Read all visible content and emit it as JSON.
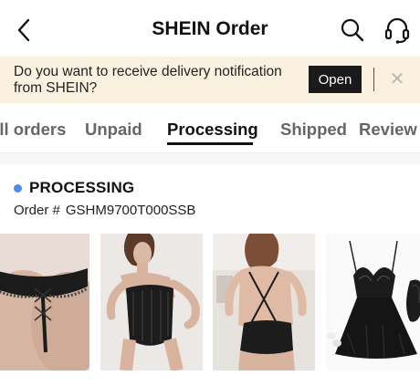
{
  "header": {
    "title": "SHEIN Order"
  },
  "notice": {
    "text": "Do you want to receive delivery notification from SHEIN?",
    "open_label": "Open",
    "close_symbol": "✕"
  },
  "tabs": [
    {
      "label": "All orders"
    },
    {
      "label": "Unpaid"
    },
    {
      "label": "Processing"
    },
    {
      "label": "Shipped"
    },
    {
      "label": "Review"
    }
  ],
  "active_tab": "Processing",
  "order": {
    "status": "PROCESSING",
    "status_color": "#4a8de8",
    "order_label": "Order #",
    "order_number": "GSHM9700T000SSB",
    "items": [
      {
        "icon": "lace-thong-product"
      },
      {
        "icon": "lace-corset-bodysuit-product"
      },
      {
        "icon": "lace-bodysuit-back-product"
      },
      {
        "icon": "lace-babydoll-product"
      }
    ]
  }
}
